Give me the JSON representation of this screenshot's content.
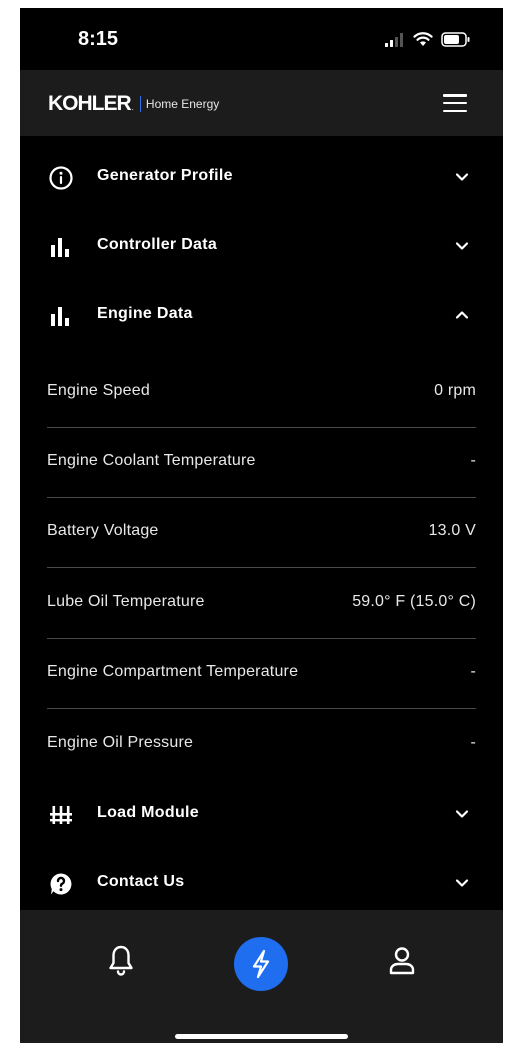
{
  "status_bar": {
    "time": "8:15"
  },
  "header": {
    "brand": "KOHLER",
    "brand_dot": ".",
    "brand_sub": "Home Energy"
  },
  "sections": {
    "generator_profile": {
      "title": "Generator Profile",
      "icon": "info-icon",
      "expanded": false
    },
    "controller_data": {
      "title": "Controller Data",
      "icon": "bar-chart-icon",
      "expanded": false
    },
    "engine_data": {
      "title": "Engine Data",
      "icon": "bar-chart-icon",
      "expanded": true
    },
    "load_module": {
      "title": "Load Module",
      "icon": "load-module-icon",
      "expanded": false
    },
    "contact_us": {
      "title": "Contact Us",
      "icon": "help-icon",
      "expanded": false
    }
  },
  "engine_rows": [
    {
      "label": "Engine Speed",
      "value": "0 rpm"
    },
    {
      "label": "Engine Coolant Temperature",
      "value": "-"
    },
    {
      "label": "Battery Voltage",
      "value": "13.0 V"
    },
    {
      "label": "Lube Oil Temperature",
      "value": "59.0° F (15.0° C)"
    },
    {
      "label": "Engine Compartment Temperature",
      "value": "-"
    },
    {
      "label": "Engine Oil Pressure",
      "value": "-"
    }
  ],
  "bottom_nav": {
    "items": [
      "bell-icon",
      "lightning-icon",
      "user-icon"
    ],
    "active": "lightning-icon"
  },
  "colors": {
    "background": "#000000",
    "header": "#1c1c1c",
    "accent": "#1f6ef0",
    "divider": "#4a4a4a"
  }
}
